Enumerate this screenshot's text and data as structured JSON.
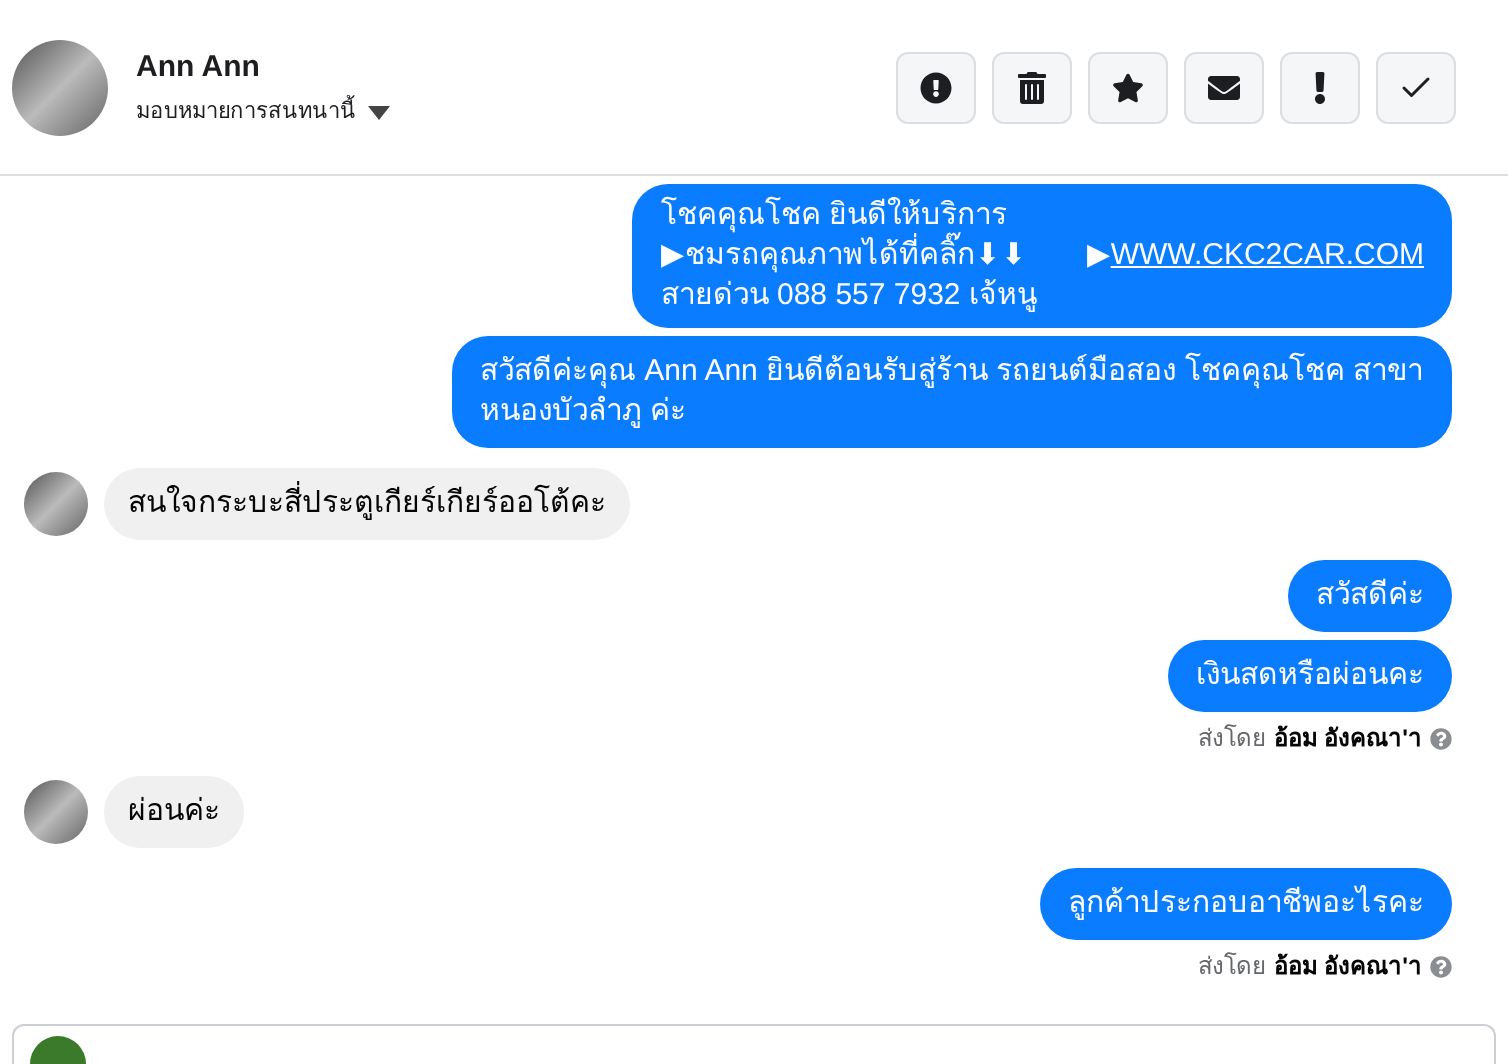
{
  "header": {
    "name": "Ann Ann",
    "assign_label": "มอบหมายการสนทนานี้"
  },
  "messages": [
    {
      "kind": "outgoing_rich",
      "lines": [
        {
          "text": "โชคคุณโชค ยินดีให้บริการ"
        },
        {
          "text": "▶ชมรถคุณภาพได้ที่คลิ๊ก⬇⬇",
          "prefix": "▶",
          "link": "WWW.CKC2CAR.COM"
        },
        {
          "text": "สายด่วน 088 557 7932 เจ้หนู"
        }
      ]
    },
    {
      "kind": "outgoing",
      "text": "สวัสดีค่ะคุณ Ann Ann ยินดีต้อนรับสู่ร้าน รถยนต์มือสอง โชคคุณโชค สาขาหนองบัวลำภู ค่ะ"
    },
    {
      "kind": "incoming",
      "text": "สนใจกระบะสี่ประตูเกียร์เกียร์ออโต้คะ"
    },
    {
      "kind": "outgoing",
      "text": "สวัสดีค่ะ"
    },
    {
      "kind": "outgoing",
      "text": "เงินสดหรือผ่อนคะ"
    },
    {
      "kind": "caption",
      "prefix": "ส่งโดย",
      "sender": "อ้อม อังคณา'า"
    },
    {
      "kind": "incoming",
      "text": "ผ่อนค่ะ"
    },
    {
      "kind": "outgoing",
      "text": "ลูกค้าประกอบอาชีพอะไรคะ"
    },
    {
      "kind": "caption",
      "prefix": "ส่งโดย",
      "sender": "อ้อม อังคณา'า"
    }
  ]
}
